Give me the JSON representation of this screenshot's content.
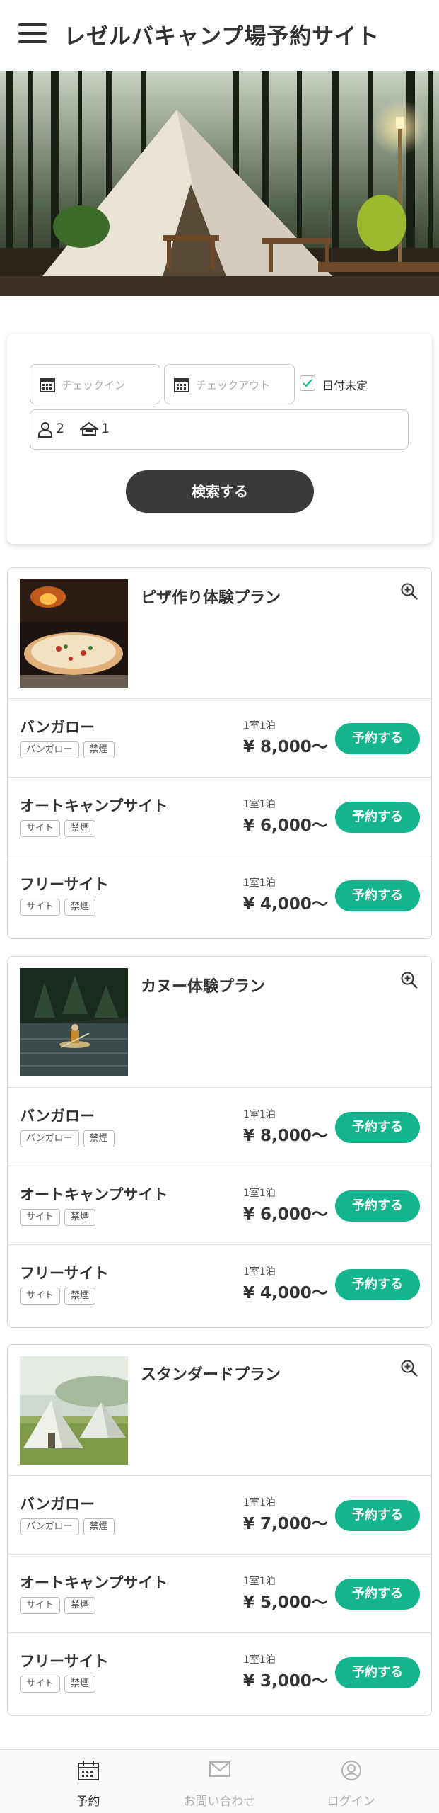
{
  "header": {
    "title": "レゼルバキャンプ場予約サイト"
  },
  "search": {
    "checkin_placeholder": "チェックイン",
    "checkout_placeholder": "チェックアウト",
    "date_undecided_label": "日付未定",
    "date_undecided_checked": true,
    "adults": "2",
    "rooms": "1",
    "submit_label": "検索する"
  },
  "plans": [
    {
      "name": "ピザ作り体験プラン",
      "rooms": [
        {
          "name": "バンガロー",
          "tags": [
            "バンガロー",
            "禁煙"
          ],
          "unit": "1室1泊",
          "price": "¥ 8,000〜",
          "button": "予約する"
        },
        {
          "name": "オートキャンプサイト",
          "tags": [
            "サイト",
            "禁煙"
          ],
          "unit": "1室1泊",
          "price": "¥ 6,000〜",
          "button": "予約する"
        },
        {
          "name": "フリーサイト",
          "tags": [
            "サイト",
            "禁煙"
          ],
          "unit": "1室1泊",
          "price": "¥ 4,000〜",
          "button": "予約する"
        }
      ]
    },
    {
      "name": "カヌー体験プラン",
      "rooms": [
        {
          "name": "バンガロー",
          "tags": [
            "バンガロー",
            "禁煙"
          ],
          "unit": "1室1泊",
          "price": "¥ 8,000〜",
          "button": "予約する"
        },
        {
          "name": "オートキャンプサイト",
          "tags": [
            "サイト",
            "禁煙"
          ],
          "unit": "1室1泊",
          "price": "¥ 6,000〜",
          "button": "予約する"
        },
        {
          "name": "フリーサイト",
          "tags": [
            "サイト",
            "禁煙"
          ],
          "unit": "1室1泊",
          "price": "¥ 4,000〜",
          "button": "予約する"
        }
      ]
    },
    {
      "name": "スタンダードプラン",
      "rooms": [
        {
          "name": "バンガロー",
          "tags": [
            "バンガロー",
            "禁煙"
          ],
          "unit": "1室1泊",
          "price": "¥ 7,000〜",
          "button": "予約する"
        },
        {
          "name": "オートキャンプサイト",
          "tags": [
            "サイト",
            "禁煙"
          ],
          "unit": "1室1泊",
          "price": "¥ 5,000〜",
          "button": "予約する"
        },
        {
          "name": "フリーサイト",
          "tags": [
            "サイト",
            "禁煙"
          ],
          "unit": "1室1泊",
          "price": "¥ 3,000〜",
          "button": "予約する"
        }
      ]
    }
  ],
  "bottom_nav": {
    "items": [
      {
        "label": "予約",
        "icon": "calendar-icon",
        "active": true
      },
      {
        "label": "お問い合わせ",
        "icon": "mail-icon",
        "active": false
      },
      {
        "label": "ログイン",
        "icon": "user-circle-icon",
        "active": false
      }
    ]
  },
  "colors": {
    "accent": "#14b58d",
    "dark_button": "#3a3a3a",
    "active_nav": "#333333",
    "inactive_nav": "#b0b0b0"
  }
}
